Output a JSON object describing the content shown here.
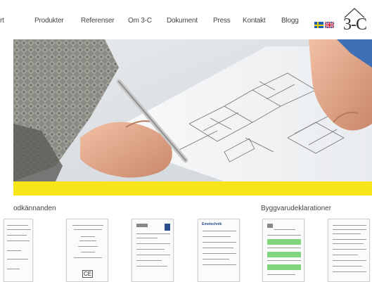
{
  "nav": {
    "items": [
      {
        "label": "rt"
      },
      {
        "label": "Produkter"
      },
      {
        "label": "Referenser"
      },
      {
        "label": "Om 3-C"
      },
      {
        "label": "Dokument"
      },
      {
        "label": "Press"
      },
      {
        "label": "Kontakt"
      },
      {
        "label": "Blogg"
      }
    ],
    "flags": [
      "swedish-flag-icon",
      "uk-flag-icon"
    ],
    "logo_text": "3-C"
  },
  "hero": {
    "description_icon": "hand-drawing-blueprint-image"
  },
  "colors": {
    "accent_bar": "#f7e51a",
    "nav_text": "#444444"
  },
  "sections": {
    "certificates_title": "odkännanden",
    "declarations_title": "Byggvarudeklarationer"
  },
  "thumbs": {
    "ce_mark": "CE",
    "brand_label": "Emotechnik"
  }
}
